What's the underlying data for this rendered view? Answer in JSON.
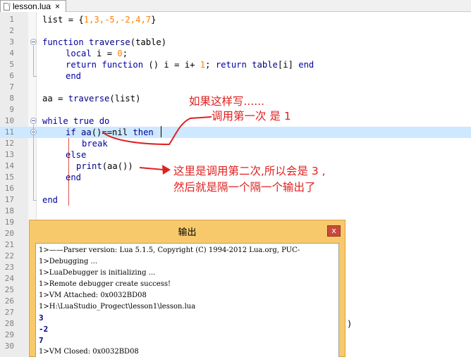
{
  "tab": {
    "label": "lesson.lua",
    "close_label": "×"
  },
  "editor": {
    "line_numbers": [
      "1",
      "2",
      "3",
      "4",
      "5",
      "6",
      "7",
      "8",
      "9",
      "10",
      "11",
      "12",
      "13",
      "14",
      "15",
      "16",
      "17",
      "18",
      "19",
      "20",
      "21",
      "22",
      "23",
      "24",
      "25",
      "26",
      "27",
      "28",
      "29",
      "30"
    ],
    "code": {
      "l1_list": "list",
      "l1_rest": " = {",
      "l1_vals": "1,3,-5,-2,4,7",
      "l1_close": "}",
      "l3_kw": "function",
      "l3_name": " traverse",
      "l3_rest": "(table)",
      "l4_kw": "local",
      "l4_rest": " i = ",
      "l4_num": "0",
      "l4_end": ";",
      "l5_kw1": "return",
      "l5_kw2": " function",
      "l5_mid": " () i = i+ ",
      "l5_num": "1",
      "l5_semi": "; ",
      "l5_kw3": "return",
      "l5_tbl": " table",
      "l5_idx": "[i] ",
      "l5_kw4": "end",
      "l6_kw": "end",
      "l8_a": "aa = ",
      "l8_fn": "traverse",
      "l8_b": "(list)",
      "l10_kw1": "while",
      "l10_kw2": " true",
      "l10_kw3": " do",
      "l11_kw1": "if",
      "l11_a": " aa",
      "l11_b": "()==nil ",
      "l11_kw2": "then",
      "l12_kw": "break",
      "l13_kw": "else",
      "l14_fn": "print",
      "l14_rest": "(aa())",
      "l15_kw": "end",
      "l17_kw": "end",
      "l28_tail": ")"
    }
  },
  "annotations": {
    "note1_line1": "如果这样写......",
    "note1_line2": "调用第一次 是 1",
    "note2_line1": "这里是调用第二次,所以会是 3 ,",
    "note2_line2": "然后就是隔一个隔一个输出了"
  },
  "output": {
    "title": "输出",
    "close_label": "x",
    "lines": [
      "1>——Parser version: Lua 5.1.5, Copyright (C) 1994-2012 Lua.org, PUC-",
      "1>Debugging ...",
      "1>LuaDebugger is initializing ...",
      "1>Remote debugger create success!",
      "1>VM Attached: 0x0032BD08",
      "1>H:\\LuaStudio_Progect\\lesson1\\lesson.lua",
      "3",
      "-2",
      "7",
      "1>VM Closed: 0x0032BD08"
    ]
  },
  "colors": {
    "keyword": "#0000a0",
    "number": "#ff8000",
    "annotation": "#e02020",
    "current_line": "#cde8ff",
    "output_frame": "#f7c96b"
  }
}
